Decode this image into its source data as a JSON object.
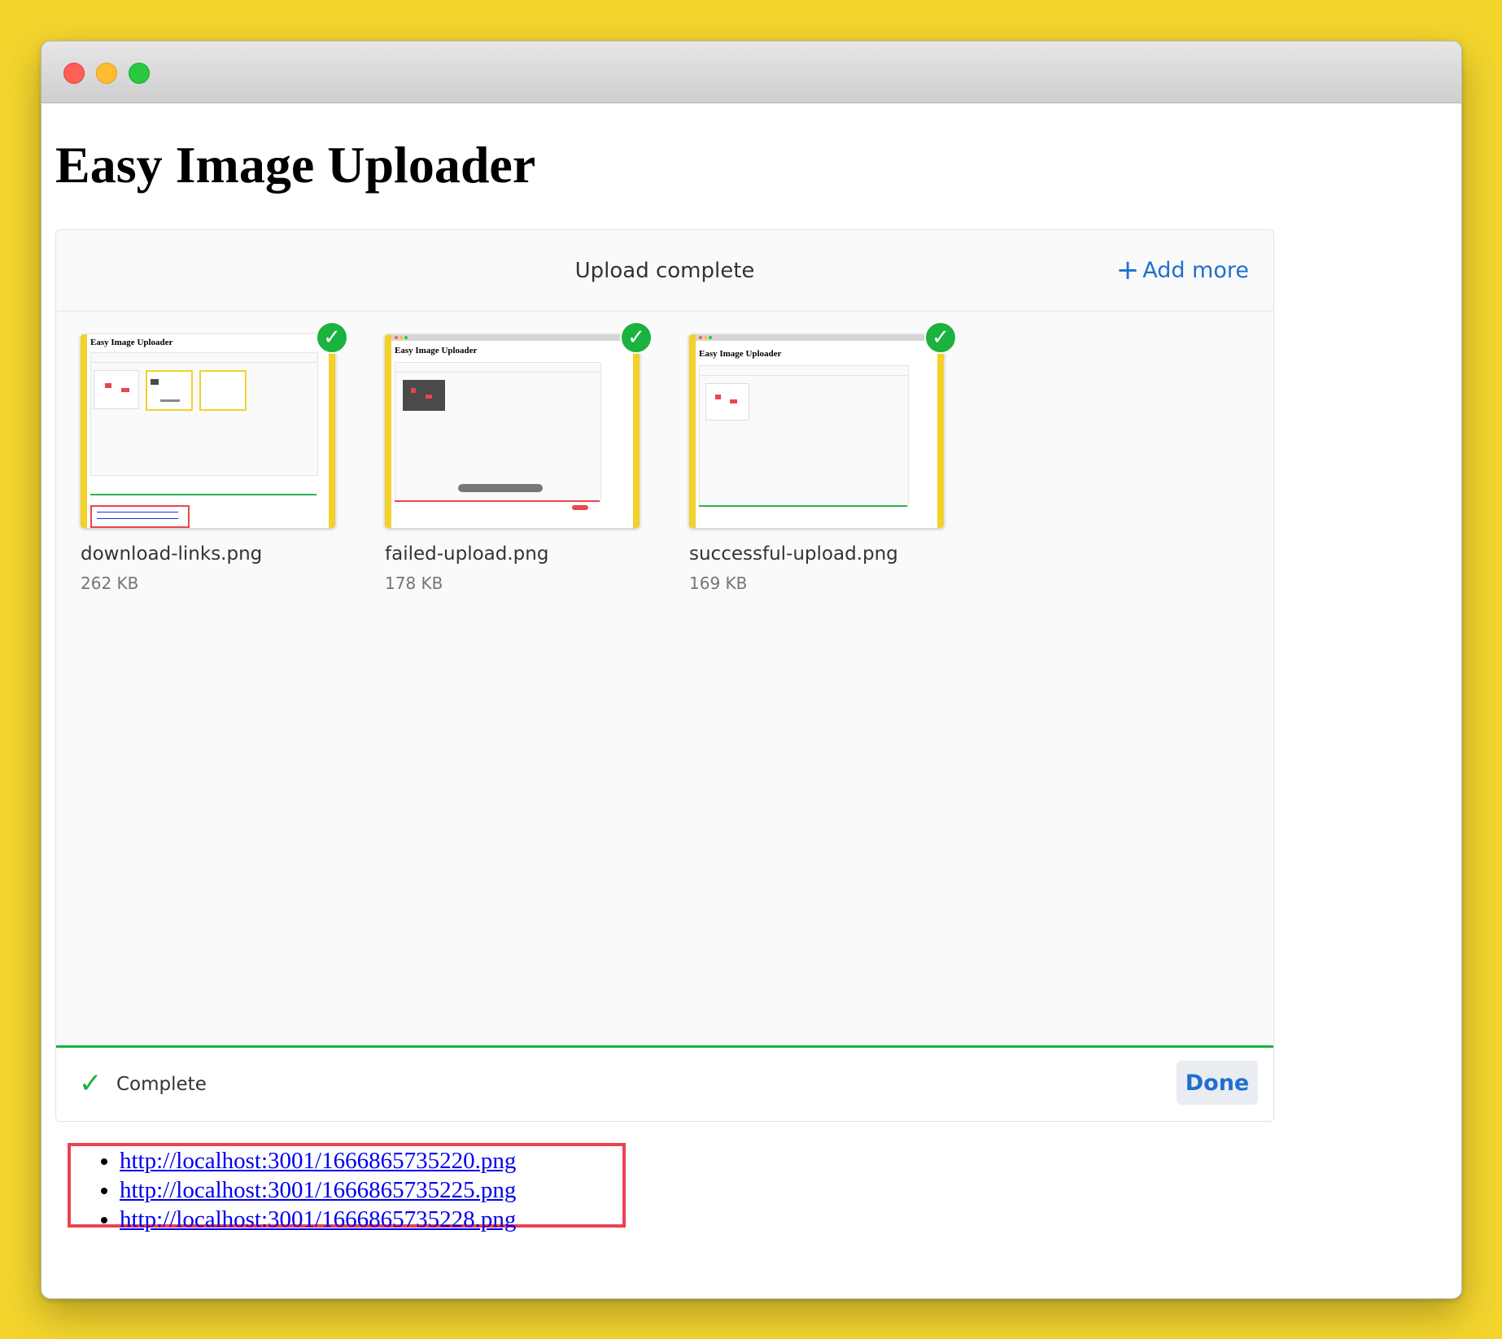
{
  "page": {
    "title": "Easy Image Uploader"
  },
  "dashboard": {
    "header_title": "Upload complete",
    "add_more_icon": "plus-icon",
    "add_more_label": "Add more",
    "files": [
      {
        "name": "download-links.png",
        "size": "262 KB",
        "status_icon": "check-circle-icon",
        "mini_title": "Easy Image Uploader"
      },
      {
        "name": "failed-upload.png",
        "size": "178 KB",
        "status_icon": "check-circle-icon",
        "mini_title": "Easy Image Uploader"
      },
      {
        "name": "successful-upload.png",
        "size": "169 KB",
        "status_icon": "check-circle-icon",
        "mini_title": "Easy Image Uploader"
      }
    ],
    "status_icon": "checkmark-icon",
    "status_text": "Complete",
    "done_label": "Done",
    "progress_fraction": 1.0
  },
  "links": [
    "http://localhost:3001/1666865735220.png",
    "http://localhost:3001/1666865735225.png",
    "http://localhost:3001/1666865735228.png"
  ],
  "colors": {
    "background": "#f4d52e",
    "accent_blue": "#1f6fd1",
    "success_green": "#1bb240",
    "highlight_red": "#ea4250",
    "link_blue": "#0000ee"
  }
}
